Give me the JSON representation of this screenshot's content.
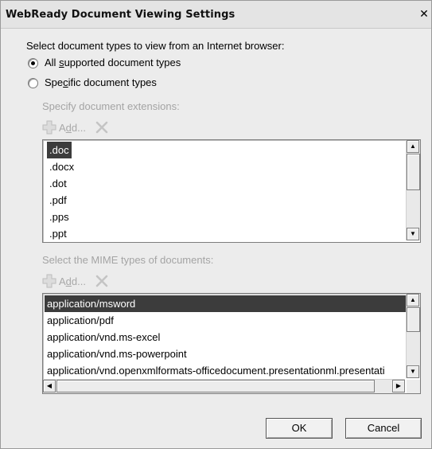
{
  "window": {
    "title": "WebReady Document Viewing Settings",
    "close_glyph": "✕"
  },
  "instructions": "Select document types to view from an Internet browser:",
  "options": {
    "all": {
      "pre": "All ",
      "accel": "s",
      "post": "upported document types",
      "selected": true
    },
    "specific": {
      "pre": "Spe",
      "accel": "c",
      "post": "ific document types",
      "selected": false
    }
  },
  "extensions": {
    "heading": "Specify document extensions:",
    "add_label_pre": "A",
    "add_label_accel": "d",
    "add_label_post": "d...",
    "items": [
      ".doc",
      ".docx",
      ".dot",
      ".pdf",
      ".pps",
      ".ppt"
    ],
    "selected_index": 0
  },
  "mime": {
    "heading": "Select the MIME types of documents:",
    "add_label_pre": "A",
    "add_label_accel": "d",
    "add_label_post": "d...",
    "items": [
      "application/msword",
      "application/pdf",
      "application/vnd.ms-excel",
      "application/vnd.ms-powerpoint",
      "application/vnd.openxmlformats-officedocument.presentationml.presentati"
    ],
    "selected_index": 0
  },
  "buttons": {
    "ok": "OK",
    "cancel": "Cancel"
  },
  "icons": {
    "add": "plus-icon",
    "delete": "x-icon"
  }
}
